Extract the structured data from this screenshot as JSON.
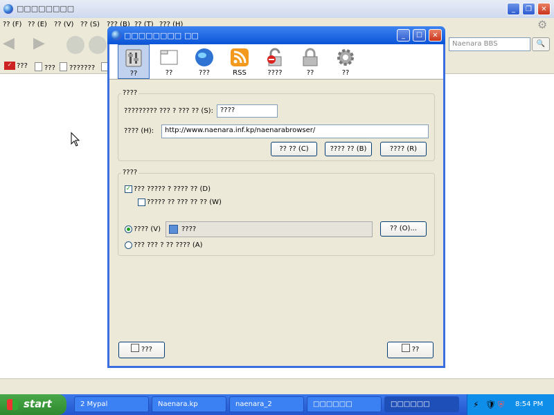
{
  "browser": {
    "title": "□□□□□□□□",
    "menu": [
      "?? (F)",
      "?? (E)",
      "?? (V)",
      "?? (S)",
      "??? (B)",
      "?? (T)",
      "??? (H)"
    ],
    "search_placeholder": "Naenara BBS",
    "bookmarks": [
      "???",
      "???",
      "???????",
      "?"
    ]
  },
  "dialog": {
    "title": "□□□□□□□□ □□",
    "panes": [
      "??",
      "??",
      "???",
      "RSS",
      "????",
      "??",
      "??"
    ],
    "group1": {
      "title": "????",
      "encoding_label": "????????? ??? ? ??? ?? (S):",
      "encoding_value": "????",
      "home_label": "???? (H):",
      "home_url": "http://www.naenara.inf.kp/naenarabrowser/",
      "buttons": [
        "?? ?? (C)",
        "???? ?? (B)",
        "???? (R)"
      ]
    },
    "group2": {
      "title": "????",
      "check_default_label": "??? ????? ? ???? ?? (D)",
      "check_default_checked": true,
      "check_warn_label": "????? ?? ??? ?? ?? (W)",
      "check_warn_checked": false,
      "radio_use_label": "???? (V)",
      "radio_use_selected": true,
      "radio_use_value": "????",
      "select_button": "?? (O)...",
      "radio_ask_label": "??? ??? ? ?? ???? (A)"
    },
    "footer": {
      "left_button": "???",
      "right_button": "??"
    }
  },
  "taskbar": {
    "start_label": "start",
    "tasks": [
      "2 Mypal",
      "Naenara.kp",
      "naenara_2",
      "□□□□□□",
      "□□□□□□"
    ],
    "clock": "8:54 PM"
  }
}
